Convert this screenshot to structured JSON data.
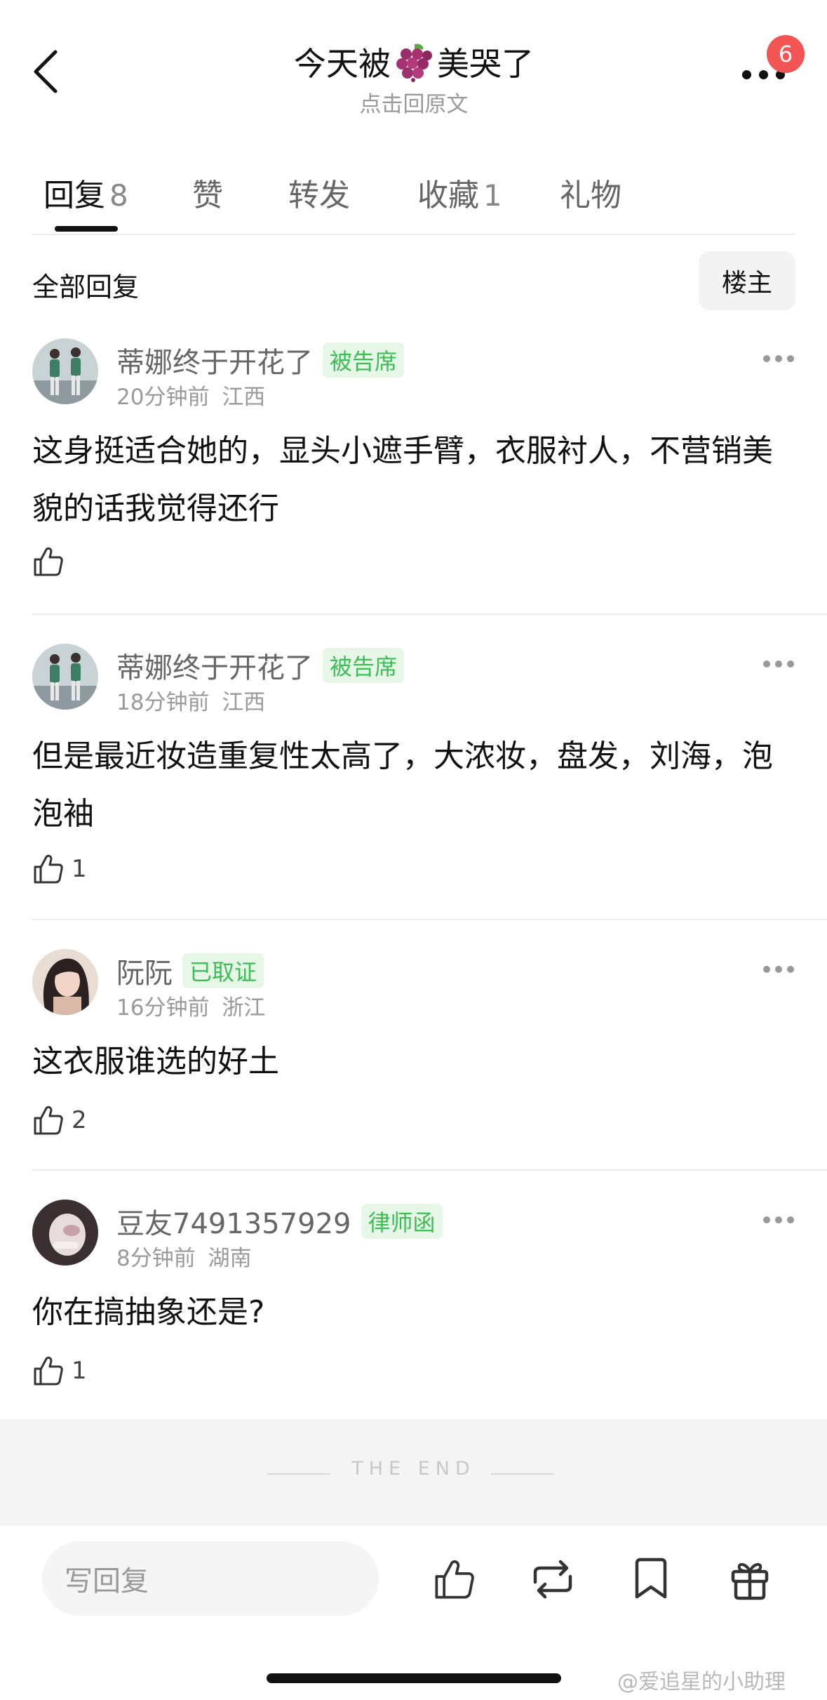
{
  "header": {
    "title_left": "今天被",
    "title_right": "美哭了",
    "emoji_icon": "grapes-icon",
    "subtitle": "点击回原文",
    "badge": "6"
  },
  "tabs": [
    {
      "label": "回复",
      "count": "8"
    },
    {
      "label": "赞",
      "count": ""
    },
    {
      "label": "转发",
      "count": ""
    },
    {
      "label": "收藏",
      "count": "1"
    },
    {
      "label": "礼物",
      "count": ""
    }
  ],
  "subheader": {
    "title": "全部回复",
    "owner_button": "楼主"
  },
  "comments": [
    {
      "username": "蒂娜终于开花了",
      "tag": "被告席",
      "time": "20分钟前",
      "location": "江西",
      "text": "这身挺适合她的，显头小遮手臂，衣服衬人，不营销美貌的话我觉得还行",
      "likes": ""
    },
    {
      "username": "蒂娜终于开花了",
      "tag": "被告席",
      "time": "18分钟前",
      "location": "江西",
      "text": "但是最近妆造重复性太高了，大浓妆，盘发，刘海，泡泡袖",
      "likes": "1"
    },
    {
      "username": "阮阮",
      "tag": "已取证",
      "time": "16分钟前",
      "location": "浙江",
      "text": "这衣服谁选的好土",
      "likes": "2"
    },
    {
      "username": "豆友7491357929",
      "tag": "律师函",
      "time": "8分钟前",
      "location": "湖南",
      "text": "你在搞抽象还是?",
      "likes": "1"
    }
  ],
  "end_text": "THE END",
  "bottom_bar": {
    "reply_placeholder": "写回复"
  },
  "watermark": "@爱追星的小助理",
  "colors": {
    "tag_green": "#3ebd57",
    "tag_bg": "#e6f7e8",
    "badge_red": "#f25553"
  }
}
